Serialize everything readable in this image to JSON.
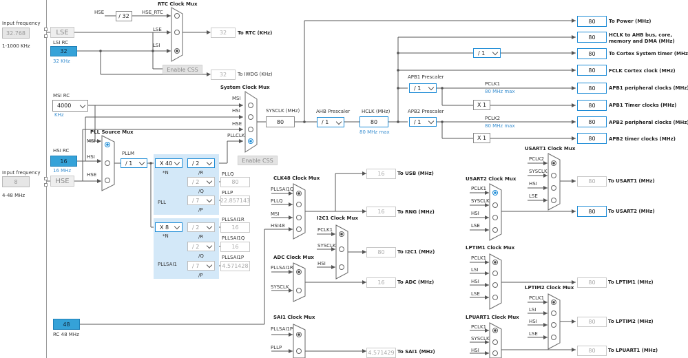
{
  "left": {
    "input_freq_1": "Input frequency",
    "lse_input": "32.768",
    "lse_range": "1-1000 KHz",
    "input_freq_2": "Input frequency",
    "hse_input": "8",
    "hse_range": "4-48 MHz"
  },
  "sources": {
    "lse": "LSE",
    "lsi_rc": "LSI RC",
    "lsi_val": "32",
    "lsi_unit": "32 KHz",
    "msi_rc": "MSI RC",
    "msi_val": "4000",
    "msi_unit": "KHz",
    "hsi_rc": "HSI RC",
    "hsi_val": "16",
    "hsi_unit": "16 MHz",
    "hse": "HSE",
    "rc48_val": "48",
    "rc48": "RC 48 MHz"
  },
  "rtc": {
    "title": "RTC Clock Mux",
    "hse": "HSE",
    "div": "/ 32",
    "hse_rtc": "HSE_RTC",
    "lse": "LSE",
    "lsi": "LSI",
    "out": "32",
    "to_rtc": "To RTC (KHz)",
    "css": "Enable CSS",
    "iwdg_out": "32",
    "to_iwdg": "To IWDG (KHz)"
  },
  "sysmux": {
    "title": "System Clock Mux",
    "msi": "MSI",
    "hsi": "HSI",
    "hse": "HSE",
    "pllclk": "PLLCLK",
    "sysclk_lbl": "SYSCLK (MHz)",
    "sysclk": "80",
    "css": "Enable CSS"
  },
  "ahb": {
    "title": "AHB Prescaler",
    "val": "/ 1",
    "hclk_lbl": "HCLK (MHz)",
    "hclk": "80",
    "hclk_max": "80 MHz max"
  },
  "apb1": {
    "title": "APB1 Prescaler",
    "val": "/ 1",
    "pclk": "PCLK1",
    "pclk_max": "80 MHz max",
    "x": "X 1"
  },
  "apb2": {
    "title": "APB2 Prescaler",
    "val": "/ 1",
    "pclk": "PCLK2",
    "pclk_max": "80 MHz max",
    "x": "X 1"
  },
  "timer_div": "/ 1",
  "outputs": [
    {
      "val": "80",
      "label": "To Power (MHz)"
    },
    {
      "val": "80",
      "label": "HCLK to AHB bus, core,"
    },
    {
      "val": "80",
      "label": "To Cortex System timer (MHz)"
    },
    {
      "val": "80",
      "label": "FCLK Cortex clock (MHz)"
    },
    {
      "val": "80",
      "label": "APB1 peripheral clocks (MHz)"
    },
    {
      "val": "80",
      "label": "APB1 Timer clocks (MHz)"
    },
    {
      "val": "80",
      "label": "APB2 peripheral clocks (MHz)"
    },
    {
      "val": "80",
      "label": "APB2 timer clocks (MHz)"
    }
  ],
  "hclk_label_2": "memory and DMA (MHz)",
  "pll": {
    "src_title": "PLL Source Mux",
    "msi": "MSI",
    "hsi": "HSI",
    "hse": "HSE",
    "pllm_lbl": "PLLM",
    "pllm": "/ 1",
    "n": "X 40",
    "n_lbl": "*N",
    "r": "/ 2",
    "r_lbl": "/R",
    "q": "/ 2",
    "q_lbl": "/Q",
    "p": "/ 7",
    "p_lbl": "/P",
    "name": "PLL",
    "pllq_lbl": "PLLQ",
    "pllq": "80",
    "pllp_lbl": "PLLP",
    "pllp": "22.857143"
  },
  "pllsai1": {
    "n": "X 8",
    "n_lbl": "*N",
    "r": "/ 2",
    "r_lbl": "/R",
    "q": "/ 2",
    "q_lbl": "/Q",
    "p": "/ 7",
    "p_lbl": "/P",
    "name": "PLLSAI1",
    "r_out_lbl": "PLLSAI1R",
    "r_out": "16",
    "q_out_lbl": "PLLSAI1Q",
    "q_out": "16",
    "p_out_lbl": "PLLSAI1P",
    "p_out": "4.571428"
  },
  "clk48": {
    "title": "CLK48 Clock Mux",
    "in1": "PLLSAI1Q",
    "in2": "PLLQ",
    "in3": "MSI",
    "in4": "HSI48",
    "usb": "16",
    "to_usb": "To USB (MHz)",
    "rng": "16",
    "to_rng": "To RNG (MHz)"
  },
  "i2c1": {
    "title": "I2C1 Clock Mux",
    "in1": "PCLK1",
    "in2": "SYSCLK",
    "in3": "HSI",
    "out": "80",
    "to": "To I2C1 (MHz)"
  },
  "adc": {
    "title": "ADC Clock Mux",
    "in1": "PLLSAI1R",
    "in2": "SYSCLK",
    "out": "16",
    "to": "To ADC (MHz)"
  },
  "sai1": {
    "title": "SAI1 Clock Mux",
    "in1": "PLLSAI1P",
    "in2": "PLLP",
    "out": "4.571429",
    "to": "To SAI1 (MHz)"
  },
  "usart1": {
    "title": "USART1 Clock Mux",
    "in1": "PCLK2",
    "in2": "SYSCLK",
    "in3": "HSI",
    "in4": "LSE",
    "out": "80",
    "to": "To USART1 (MHz)"
  },
  "usart2": {
    "title": "USART2 Clock Mux",
    "in1": "PCLK1",
    "in2": "SYSCLK",
    "in3": "HSI",
    "in4": "LSE",
    "out": "80",
    "to": "To USART2 (MHz)"
  },
  "lptim1": {
    "title": "LPTIM1 Clock Mux",
    "in1": "PCLK1",
    "in2": "LSI",
    "in3": "HSI",
    "in4": "LSE",
    "out": "80",
    "to": "To LPTIM1 (MHz)"
  },
  "lptim2": {
    "title": "LPTIM2 Clock Mux",
    "in1": "PCLK1",
    "in2": "LSI",
    "in3": "HSI",
    "in4": "LSE",
    "out": "80",
    "to": "To LPTIM2 (MHz)"
  },
  "lpuart1": {
    "title": "LPUART1 Clock Mux",
    "in1": "PCLK1",
    "in2": "SYSCLK",
    "in3": "HSI",
    "out": "80",
    "to": "To LPUART1 (MHz)"
  }
}
